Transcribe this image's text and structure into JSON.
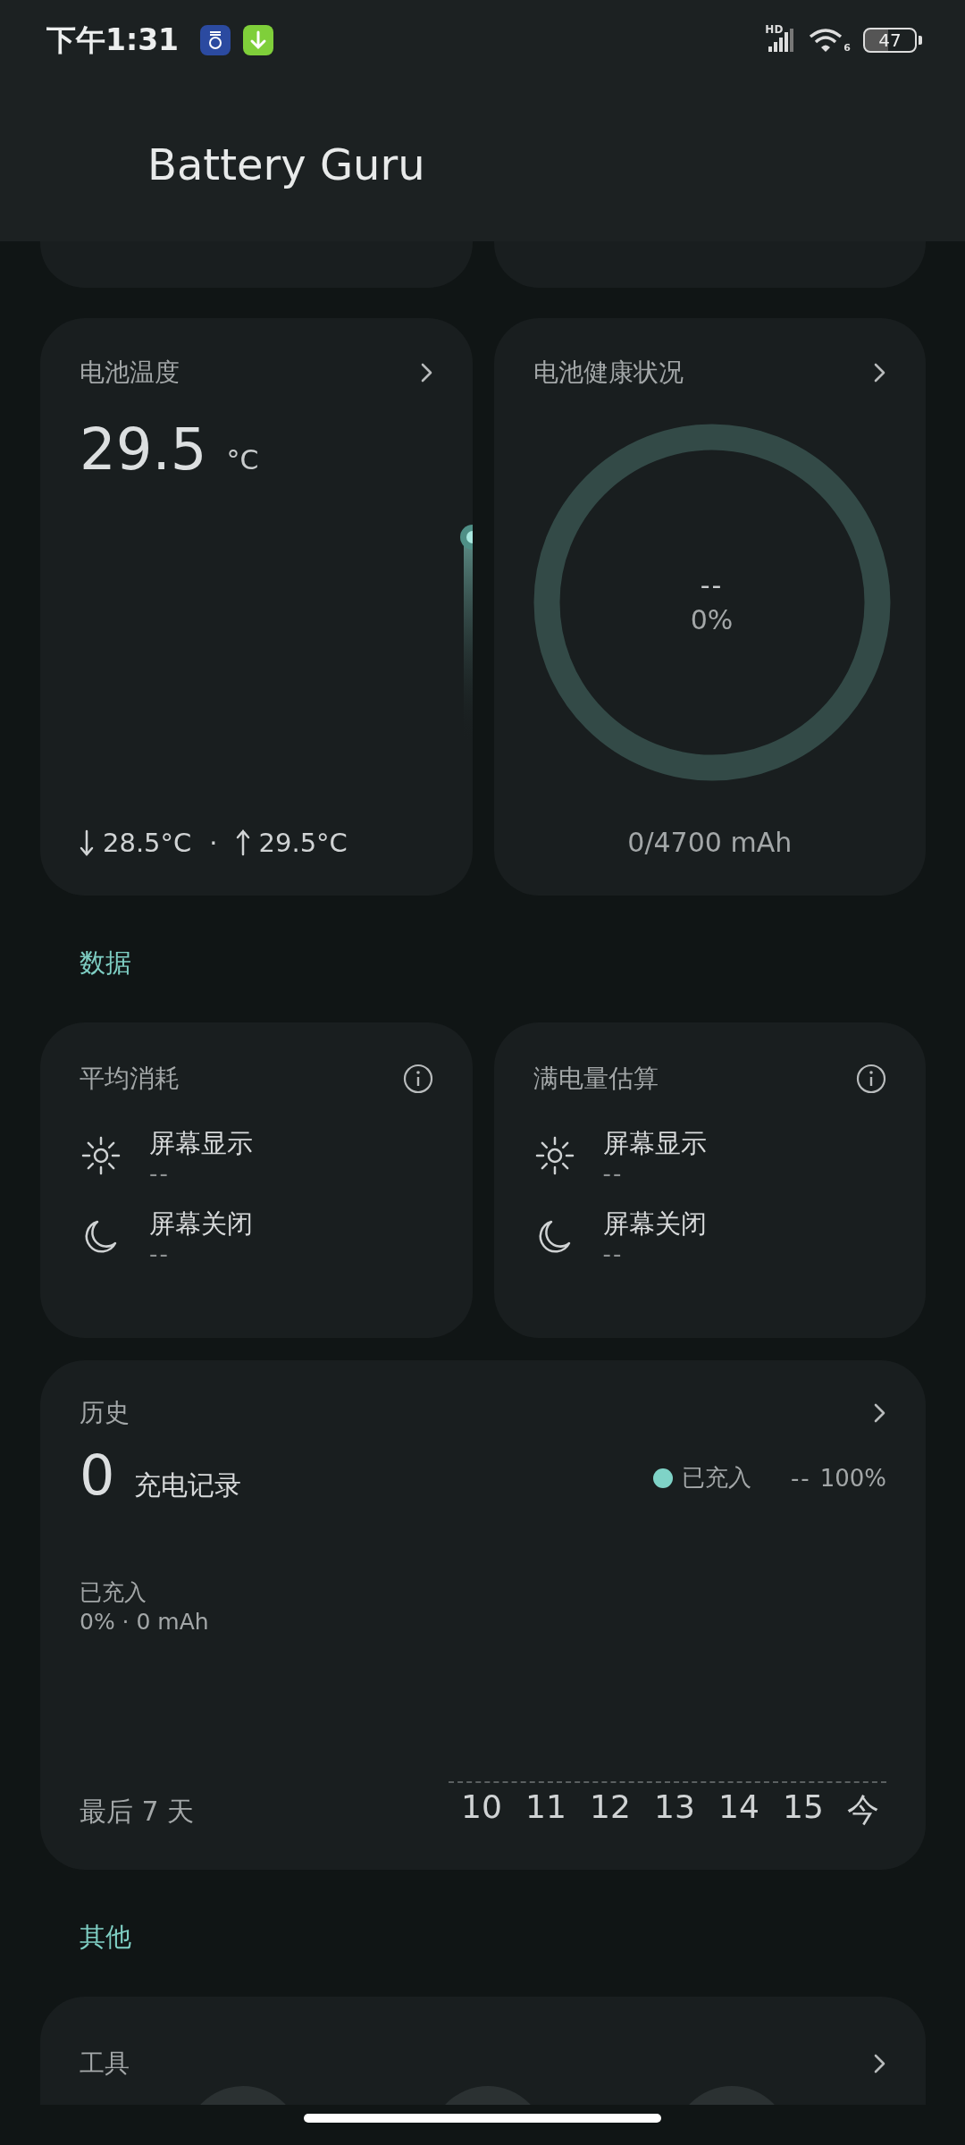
{
  "status_bar": {
    "time": "下午1:31",
    "signal_label": "HD",
    "wifi_label": "6",
    "battery": "47"
  },
  "header": {
    "title": "Battery Guru"
  },
  "temperature_card": {
    "title": "电池温度",
    "value": "29.5",
    "unit": "°C",
    "min": "28.5°C",
    "separator": "·",
    "max": "29.5°C"
  },
  "health_card": {
    "title": "电池健康状况",
    "value": "--",
    "percent": "0%",
    "capacity": "0/4700 mAh"
  },
  "data_section": {
    "label": "数据"
  },
  "usage_cards": [
    {
      "title": "平均消耗",
      "rows": [
        {
          "kind": "screen_on",
          "label": "屏幕显示",
          "value": "--"
        },
        {
          "kind": "screen_off",
          "label": "屏幕关闭",
          "value": "--"
        }
      ]
    },
    {
      "title": "满电量估算",
      "rows": [
        {
          "kind": "screen_on",
          "label": "屏幕显示",
          "value": "--"
        },
        {
          "kind": "screen_off",
          "label": "屏幕关闭",
          "value": "--"
        }
      ]
    }
  ],
  "history_card": {
    "title": "历史",
    "count": "0",
    "count_label": "充电记录",
    "legend": {
      "label": "已充入",
      "color": "#7fd3c7"
    },
    "legend_dashes": "--",
    "legend_max": "100%",
    "charged_label": "已充入",
    "charged_value": "0% · 0 mAh",
    "range": "最后 7 天",
    "days": [
      "10",
      "11",
      "12",
      "13",
      "14",
      "15",
      "今"
    ]
  },
  "other_section": {
    "label": "其他"
  },
  "tools_card": {
    "title": "工具"
  }
}
